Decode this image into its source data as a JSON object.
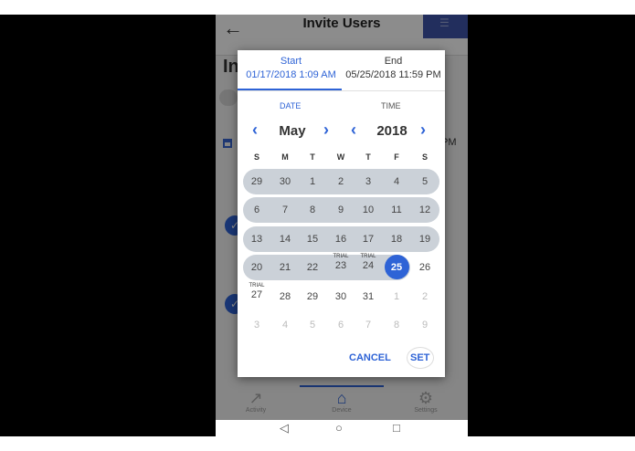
{
  "app": {
    "title": "Invite Users",
    "heading_partial": "In",
    "time_partial": "PM"
  },
  "nav": {
    "activity": "Activity",
    "device": "Device",
    "settings": "Settings"
  },
  "dialog": {
    "start_label": "Start",
    "start_value": "01/17/2018 1:09 AM",
    "end_label": "End",
    "end_value": "05/25/2018 11:59 PM",
    "date_tab": "DATE",
    "time_tab": "TIME",
    "month": "May",
    "year": "2018",
    "weekdays": [
      "S",
      "M",
      "T",
      "W",
      "T",
      "F",
      "S"
    ],
    "weeks": [
      [
        "29",
        "30",
        "1",
        "2",
        "3",
        "4",
        "5"
      ],
      [
        "6",
        "7",
        "8",
        "9",
        "10",
        "11",
        "12"
      ],
      [
        "13",
        "14",
        "15",
        "16",
        "17",
        "18",
        "19"
      ],
      [
        "20",
        "21",
        "22",
        "23",
        "24",
        "25",
        "26"
      ],
      [
        "27",
        "28",
        "29",
        "30",
        "31",
        "1",
        "2"
      ],
      [
        "3",
        "4",
        "5",
        "6",
        "7",
        "8",
        "9"
      ]
    ],
    "trial_label": "TRIAL",
    "selected_day": "25",
    "cancel_label": "CANCEL",
    "set_label": "SET"
  },
  "colors": {
    "accent": "#2e63d6",
    "range_band": "#cbd1d8"
  },
  "icons": {
    "back": "arrow-left-icon",
    "activity": "trend-icon",
    "device": "house-icon",
    "settings": "gear-icon"
  }
}
